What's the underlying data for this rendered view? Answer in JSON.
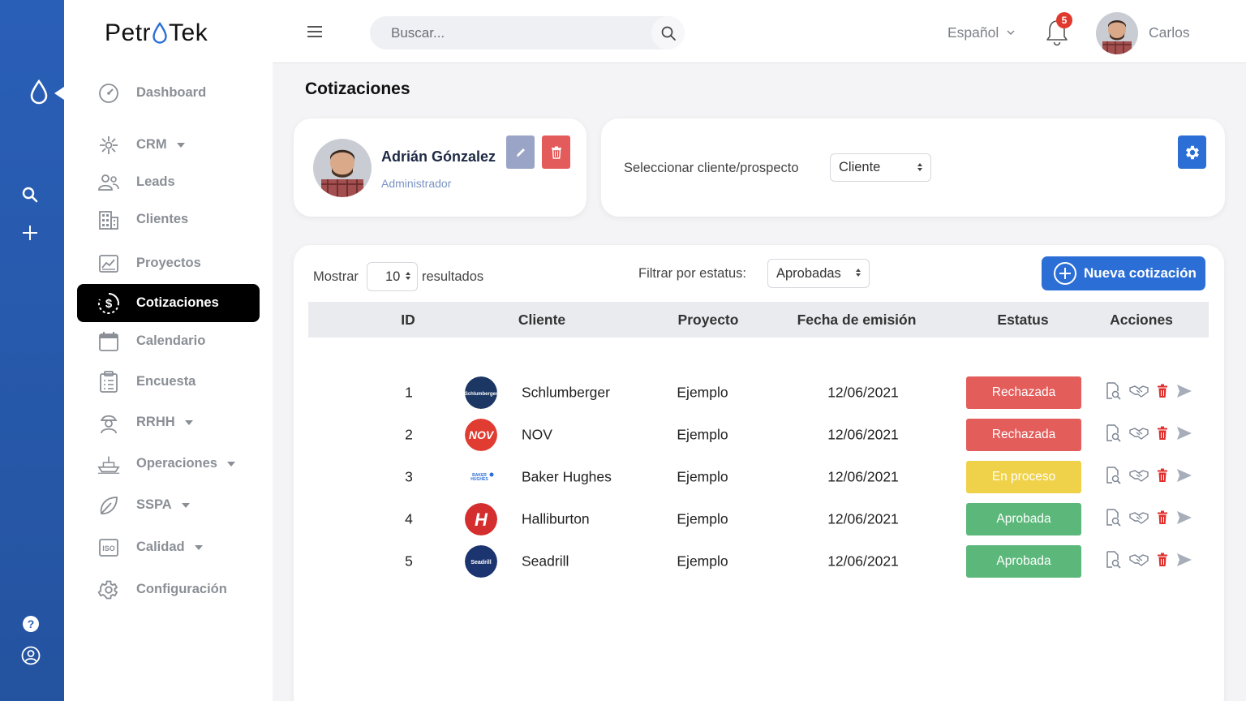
{
  "brand": {
    "left": "Petr",
    "right": "Tek"
  },
  "sidebar": {
    "items": [
      {
        "label": "Dashboard",
        "icon": "gauge-icon",
        "caret": false,
        "active": false
      },
      {
        "label": "CRM",
        "icon": "crm-network-icon",
        "caret": true,
        "active": false
      },
      {
        "label": "Leads",
        "icon": "users-icon",
        "caret": false,
        "active": false
      },
      {
        "label": "Clientes",
        "icon": "building-icon",
        "caret": false,
        "active": false
      },
      {
        "label": "Proyectos",
        "icon": "chart-image-icon",
        "caret": false,
        "active": false
      },
      {
        "label": "Cotizaciones",
        "icon": "dollar-cycle-icon",
        "caret": false,
        "active": true
      },
      {
        "label": "Calendario",
        "icon": "calendar-icon",
        "caret": false,
        "active": false
      },
      {
        "label": "Encuesta",
        "icon": "clipboard-icon",
        "caret": false,
        "active": false
      },
      {
        "label": "RRHH",
        "icon": "worker-icon",
        "caret": true,
        "active": false
      },
      {
        "label": "Operaciones",
        "icon": "ship-icon",
        "caret": true,
        "active": false
      },
      {
        "label": "SSPA",
        "icon": "leaf-icon",
        "caret": true,
        "active": false
      },
      {
        "label": "Calidad",
        "icon": "iso-icon",
        "caret": true,
        "active": false
      },
      {
        "label": "Configuración",
        "icon": "gear-icon",
        "caret": false,
        "active": false
      }
    ]
  },
  "header": {
    "search_placeholder": "Buscar...",
    "language": "Español",
    "notifications": "5",
    "user": "Carlos"
  },
  "page": {
    "title": "Cotizaciones"
  },
  "profile": {
    "name": "Adrián Gónzalez",
    "role": "Administrador"
  },
  "selector": {
    "label": "Seleccionar cliente/prospecto",
    "value": "Cliente"
  },
  "table_controls": {
    "show_label": "Mostrar",
    "show_value": "10",
    "results_label": "resultados",
    "filter_label": "Filtrar por estatus:",
    "filter_value": "Aprobadas",
    "new_button": "Nueva cotización"
  },
  "table": {
    "columns": [
      "ID",
      "Cliente",
      "Proyecto",
      "Fecha de emisión",
      "Estatus",
      "Acciones"
    ],
    "rows": [
      {
        "id": "1",
        "client": "Schlumberger",
        "logo_text": "Schlumberger",
        "logo_color": "#1c3764",
        "project": "Ejemplo",
        "date": "12/06/2021",
        "status": "Rechazada",
        "status_color": "#e35d5b"
      },
      {
        "id": "2",
        "client": "NOV",
        "logo_text": "NOV",
        "logo_color": "#e03c31",
        "project": "Ejemplo",
        "date": "12/06/2021",
        "status": "Rechazada",
        "status_color": "#e35d5b"
      },
      {
        "id": "3",
        "client": "Baker Hughes",
        "logo_text": "BAKER HUGHES",
        "logo_color": "#ffffff",
        "project": "Ejemplo",
        "date": "12/06/2021",
        "status": "En proceso",
        "status_color": "#f0d24a"
      },
      {
        "id": "4",
        "client": "Halliburton",
        "logo_text": "H",
        "logo_color": "#d42e2e",
        "project": "Ejemplo",
        "date": "12/06/2021",
        "status": "Aprobada",
        "status_color": "#5cb87a"
      },
      {
        "id": "5",
        "client": "Seadrill",
        "logo_text": "Seadrill",
        "logo_color": "#1c3470",
        "project": "Ejemplo",
        "date": "12/06/2021",
        "status": "Aprobada",
        "status_color": "#5cb87a"
      }
    ]
  },
  "colors": {
    "primary": "#2b6fd6",
    "rail": "#2a5fb8",
    "danger": "#e45b5b"
  }
}
